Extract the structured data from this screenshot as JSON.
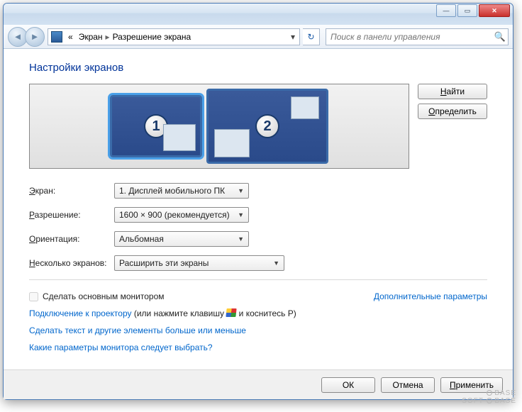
{
  "titlebar": {
    "min": "—",
    "max": "▭",
    "close": "✕"
  },
  "nav": {
    "back": "◄",
    "fwd": "►",
    "crumb_prefix": "«",
    "crumb1": "Экран",
    "crumb2": "Разрешение экрана",
    "dropdown": "▾",
    "refresh": "↻",
    "search_placeholder": "Поиск в панели управления",
    "search_icon": "🔍"
  },
  "heading": "Настройки экранов",
  "monitors": {
    "m1": "1",
    "m2": "2"
  },
  "buttons": {
    "find": "Найти",
    "find_u": "Н",
    "detect": "Определить",
    "detect_u": "О"
  },
  "labels": {
    "display": "Экран:",
    "display_u": "Э",
    "resolution": "Разрешение:",
    "resolution_u": "Р",
    "orientation": "Ориентация:",
    "orientation_u": "О",
    "multi": "Несколько экранов:",
    "multi_u": "Н"
  },
  "values": {
    "display": "1. Дисплей мобильного ПК",
    "resolution": "1600 × 900 (рекомендуется)",
    "orientation": "Альбомная",
    "multi": "Расширить эти экраны"
  },
  "checkbox": "Сделать основным монитором",
  "advanced": "Дополнительные параметры",
  "links": {
    "projector_link": "Подключение к проектору",
    "projector_rest": " (или нажмите клавишу ",
    "projector_tail": " и коснитесь P)",
    "textsize": "Сделать текст и другие элементы больше или меньше",
    "which": "Какие параметры монитора следует выбрать?"
  },
  "footer": {
    "ok": "ОК",
    "cancel": "Отмена",
    "apply": "Применить",
    "apply_u": "П"
  },
  "watermark": {
    "l1": "BASE",
    "l2": "SOFT",
    "l3": "BASE"
  }
}
